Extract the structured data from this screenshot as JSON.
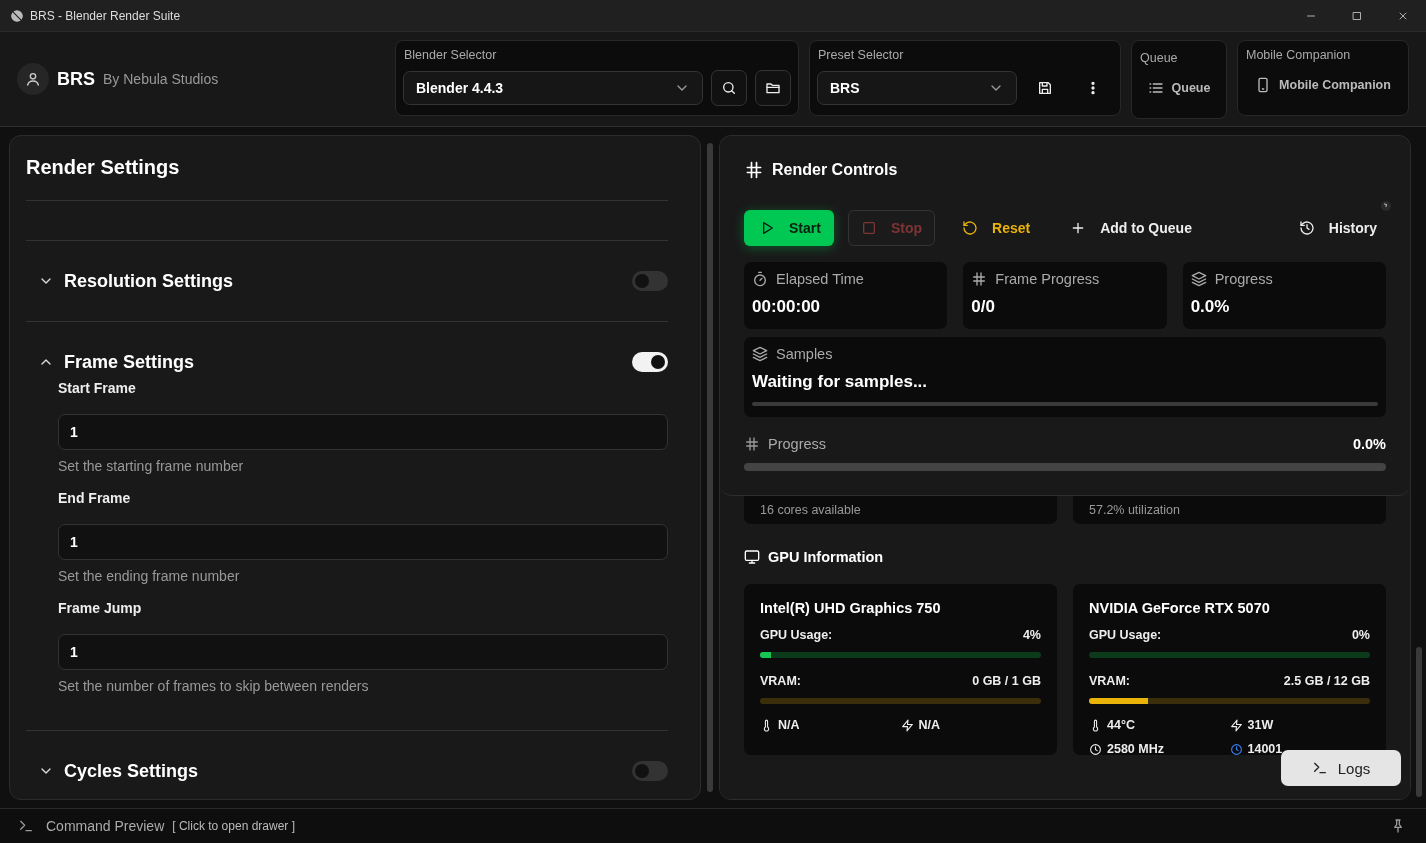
{
  "window": {
    "title": "BRS - Blender Render Suite"
  },
  "header": {
    "app_name": "BRS",
    "subtitle": "By Nebula Studios",
    "blender_selector": {
      "label": "Blender Selector",
      "value": "Blender 4.4.3"
    },
    "preset_selector": {
      "label": "Preset Selector",
      "value": "BRS"
    },
    "queue": {
      "label": "Queue",
      "button": "Queue"
    },
    "mobile_companion": {
      "label": "Mobile Companion",
      "button": "Mobile Companion"
    }
  },
  "render_settings": {
    "title": "Render Settings",
    "sections": [
      {
        "title": "Resolution Settings",
        "expanded": false,
        "enabled": false
      },
      {
        "title": "Frame Settings",
        "expanded": true,
        "enabled": true,
        "fields": [
          {
            "label": "Start Frame",
            "value": "1",
            "help": "Set the starting frame number"
          },
          {
            "label": "End Frame",
            "value": "1",
            "help": "Set the ending frame number"
          },
          {
            "label": "Frame Jump",
            "value": "1",
            "help": "Set the number of frames to skip between renders"
          }
        ]
      },
      {
        "title": "Cycles Settings",
        "expanded": false,
        "enabled": false
      }
    ]
  },
  "render_controls": {
    "title": "Render Controls",
    "buttons": [
      {
        "kind": "start",
        "label": "Start",
        "disabled": false
      },
      {
        "kind": "stop",
        "label": "Stop",
        "disabled": true
      },
      {
        "kind": "reset",
        "label": "Reset",
        "disabled": false
      },
      {
        "kind": "add",
        "label": "Add to Queue",
        "disabled": false
      },
      {
        "kind": "history",
        "label": "History",
        "disabled": false
      }
    ],
    "stats": [
      {
        "kind": "time",
        "label": "Elapsed Time",
        "value": "00:00:00"
      },
      {
        "kind": "frames",
        "label": "Frame Progress",
        "value": "0/0"
      },
      {
        "kind": "layers",
        "label": "Progress",
        "value": "0.0%"
      }
    ],
    "samples": {
      "label": "Samples",
      "value": "Waiting for samples...",
      "level": 0
    },
    "progress": {
      "label": "Progress",
      "value": "0.0%",
      "level": 0
    }
  },
  "system_cards": [
    {
      "text": "16 cores available"
    },
    {
      "text": "57.2% utilization"
    }
  ],
  "gpu": {
    "title": "GPU Information",
    "cards": [
      {
        "name": "Intel(R) UHD Graphics 750",
        "usage": {
          "label": "GPU Usage:",
          "value": "4%",
          "level": 0.04
        },
        "vram": {
          "label": "VRAM:",
          "value": "0 GB / 1 GB",
          "level": 0
        },
        "stats": [
          {
            "kind": "temperature",
            "value": "N/A"
          },
          {
            "kind": "power",
            "value": "N/A"
          }
        ]
      },
      {
        "name": "NVIDIA GeForce RTX 5070",
        "usage": {
          "label": "GPU Usage:",
          "value": "0%",
          "level": 0
        },
        "vram": {
          "label": "VRAM:",
          "value": "2.5 GB / 12 GB",
          "level": 0.21
        },
        "stats": [
          {
            "kind": "temperature",
            "value": "44°C"
          },
          {
            "kind": "power",
            "value": "31W"
          },
          {
            "kind": "clock",
            "value": "2580 MHz"
          },
          {
            "kind": "memory_clock",
            "value": "14001"
          }
        ]
      }
    ]
  },
  "logs_button": "Logs",
  "command_preview": {
    "label": "Command Preview",
    "hint": "[ Click to open drawer ]"
  }
}
